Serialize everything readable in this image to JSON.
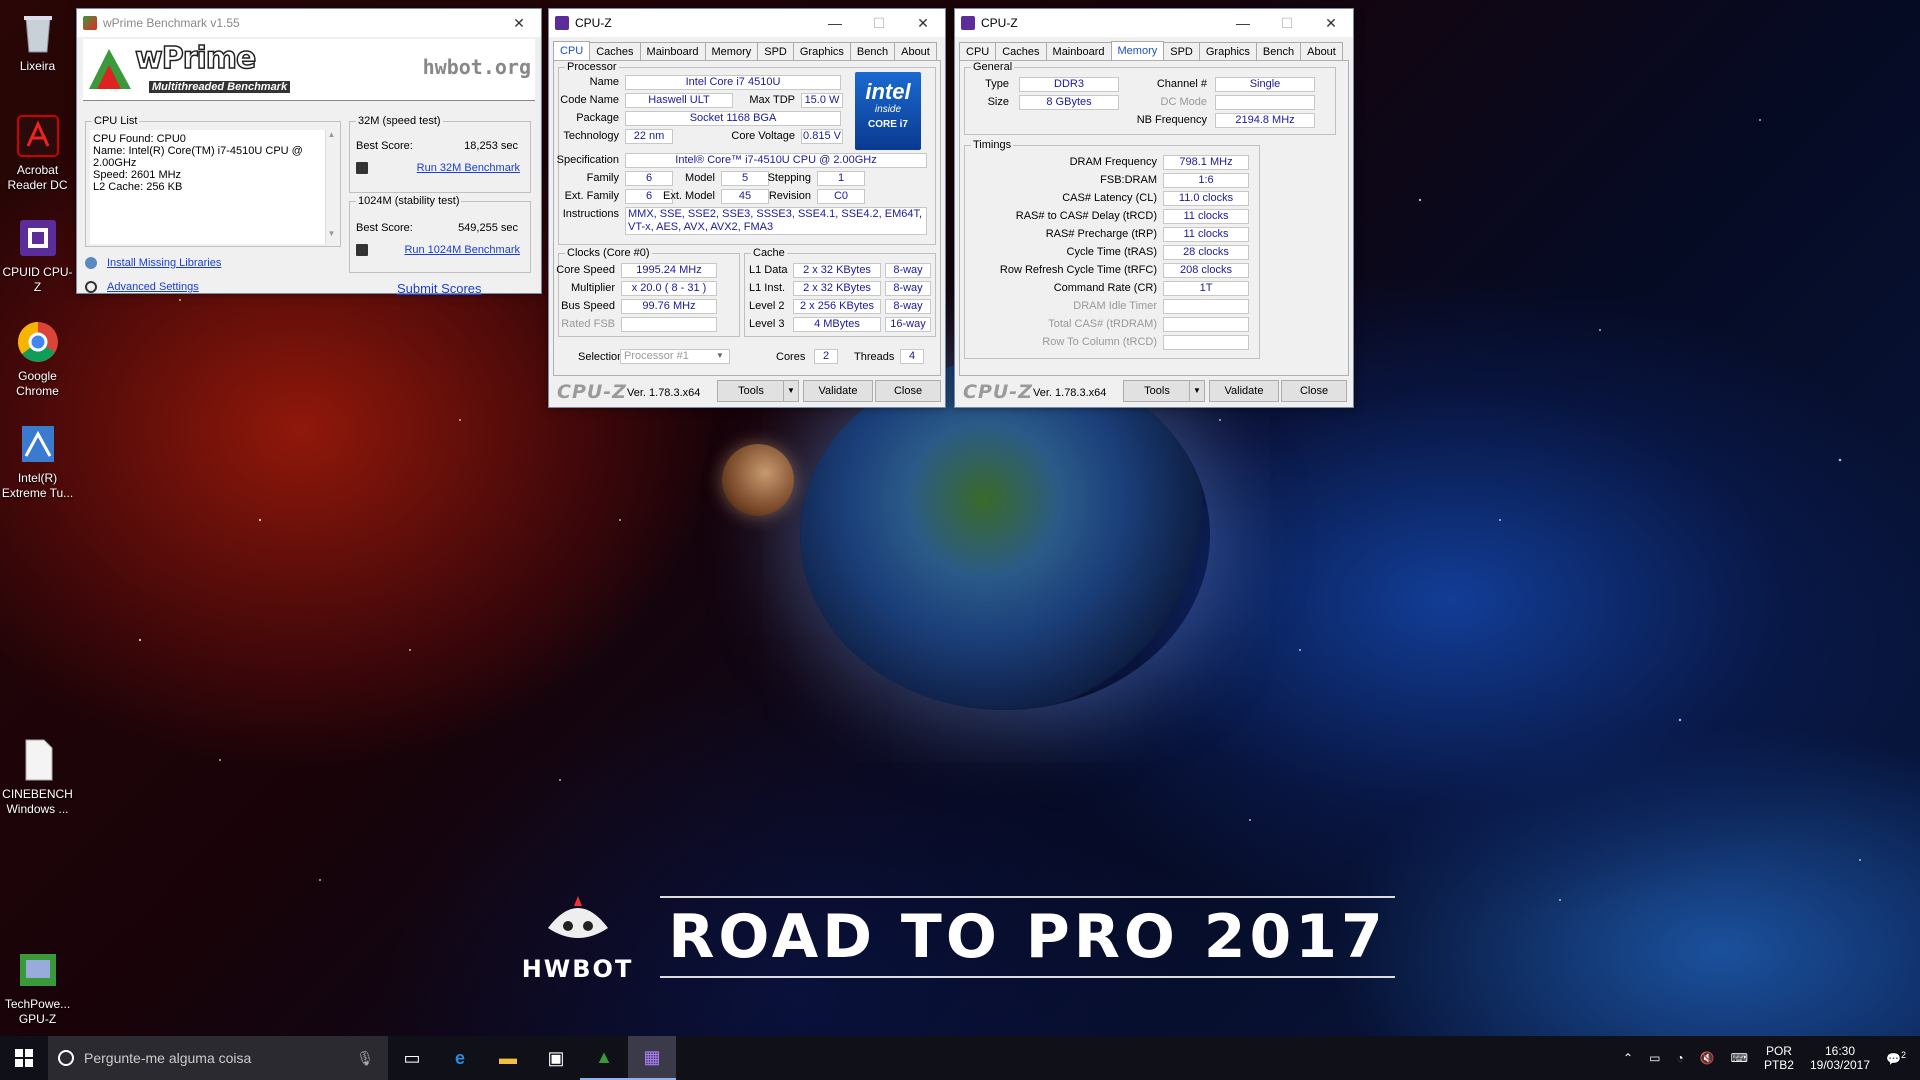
{
  "desktop": {
    "icons": [
      {
        "label": "Lixeira"
      },
      {
        "label": "Acrobat Reader DC"
      },
      {
        "label": "CPUID CPU-Z"
      },
      {
        "label": "Google Chrome"
      },
      {
        "label": "Intel(R) Extreme Tu..."
      },
      {
        "label": "CINEBENCH Windows ..."
      },
      {
        "label": "TechPowe... GPU-Z"
      }
    ],
    "banner": {
      "logo_text": "HWBOT",
      "title": "ROAD TO PRO 2017"
    }
  },
  "wprime": {
    "title": "wPrime Benchmark v1.55",
    "logo": "wPrime",
    "subtitle": "Multithreaded Benchmark",
    "hwbot": "hwbot.org",
    "cpu_list": {
      "label": "CPU List",
      "lines": [
        "CPU Found: CPU0",
        "Name:    Intel(R) Core(TM) i7-4510U CPU @",
        "2.00GHz",
        "Speed:    2601 MHz",
        "L2 Cache: 256 KB"
      ]
    },
    "test32": {
      "label": "32M (speed test)",
      "best_label": "Best Score:",
      "best": "18,253 sec",
      "run": "Run 32M Benchmark"
    },
    "test1024": {
      "label": "1024M (stability test)",
      "best_label": "Best Score:",
      "best": "549,255 sec",
      "run": "Run 1024M Benchmark"
    },
    "install_missing": "Install Missing Libraries",
    "advanced": "Advanced Settings",
    "submit": "Submit Scores"
  },
  "cpuz1": {
    "title": "CPU-Z",
    "tabs": [
      "CPU",
      "Caches",
      "Mainboard",
      "Memory",
      "SPD",
      "Graphics",
      "Bench",
      "About"
    ],
    "active_tab": "CPU",
    "processor": {
      "group": "Processor",
      "name_l": "Name",
      "name": "Intel Core i7 4510U",
      "code_l": "Code Name",
      "code": "Haswell ULT",
      "tdp_l": "Max TDP",
      "tdp": "15.0 W",
      "pkg_l": "Package",
      "pkg": "Socket 1168 BGA",
      "tech_l": "Technology",
      "tech": "22 nm",
      "volt_l": "Core Voltage",
      "volt": "0.815 V",
      "spec_l": "Specification",
      "spec": "Intel® Core™ i7-4510U CPU @ 2.00GHz",
      "family_l": "Family",
      "family": "6",
      "model_l": "Model",
      "model": "5",
      "stepping_l": "Stepping",
      "stepping": "1",
      "extfam_l": "Ext. Family",
      "extfam": "6",
      "extmod_l": "Ext. Model",
      "extmod": "45",
      "rev_l": "Revision",
      "rev": "C0",
      "instr_l": "Instructions",
      "instr": "MMX, SSE, SSE2, SSE3, SSSE3, SSE4.1, SSE4.2, EM64T, VT-x, AES, AVX, AVX2, FMA3",
      "logo_line1": "intel",
      "logo_line2": "inside",
      "logo_line3": "CORE i7"
    },
    "clocks": {
      "group": "Clocks (Core #0)",
      "core_l": "Core Speed",
      "core": "1995.24 MHz",
      "mult_l": "Multiplier",
      "mult": "x 20.0 ( 8 - 31 )",
      "bus_l": "Bus Speed",
      "bus": "99.76 MHz",
      "fsb_l": "Rated FSB",
      "fsb": ""
    },
    "cache": {
      "group": "Cache",
      "rows": [
        {
          "label": "L1 Data",
          "size": "2 x 32 KBytes",
          "way": "8-way"
        },
        {
          "label": "L1 Inst.",
          "size": "2 x 32 KBytes",
          "way": "8-way"
        },
        {
          "label": "Level 2",
          "size": "2 x 256 KBytes",
          "way": "8-way"
        },
        {
          "label": "Level 3",
          "size": "4 MBytes",
          "way": "16-way"
        }
      ]
    },
    "selection_l": "Selection",
    "selection": "Processor #1",
    "cores_l": "Cores",
    "cores": "2",
    "threads_l": "Threads",
    "threads": "4",
    "brand": "CPU-Z",
    "version": "Ver. 1.78.3.x64",
    "tools": "Tools",
    "validate": "Validate",
    "close": "Close"
  },
  "cpuz2": {
    "title": "CPU-Z",
    "tabs": [
      "CPU",
      "Caches",
      "Mainboard",
      "Memory",
      "SPD",
      "Graphics",
      "Bench",
      "About"
    ],
    "active_tab": "Memory",
    "general": {
      "group": "General",
      "type_l": "Type",
      "type": "DDR3",
      "size_l": "Size",
      "size": "8 GBytes",
      "chan_l": "Channel #",
      "chan": "Single",
      "dc_l": "DC Mode",
      "dc": "",
      "nb_l": "NB Frequency",
      "nb": "2194.8 MHz"
    },
    "timings": {
      "group": "Timings",
      "rows": [
        {
          "label": "DRAM Frequency",
          "value": "798.1 MHz",
          "disabled": false
        },
        {
          "label": "FSB:DRAM",
          "value": "1:6",
          "disabled": false
        },
        {
          "label": "CAS# Latency (CL)",
          "value": "11.0 clocks",
          "disabled": false
        },
        {
          "label": "RAS# to CAS# Delay (tRCD)",
          "value": "11 clocks",
          "disabled": false
        },
        {
          "label": "RAS# Precharge (tRP)",
          "value": "11 clocks",
          "disabled": false
        },
        {
          "label": "Cycle Time (tRAS)",
          "value": "28 clocks",
          "disabled": false
        },
        {
          "label": "Row Refresh Cycle Time (tRFC)",
          "value": "208 clocks",
          "disabled": false
        },
        {
          "label": "Command Rate (CR)",
          "value": "1T",
          "disabled": false
        },
        {
          "label": "DRAM Idle Timer",
          "value": "",
          "disabled": true
        },
        {
          "label": "Total CAS# (tRDRAM)",
          "value": "",
          "disabled": true
        },
        {
          "label": "Row To Column (tRCD)",
          "value": "",
          "disabled": true
        }
      ]
    },
    "brand": "CPU-Z",
    "version": "Ver. 1.78.3.x64",
    "tools": "Tools",
    "validate": "Validate",
    "close": "Close"
  },
  "taskbar": {
    "search_placeholder": "Pergunte-me alguma coisa",
    "lang1": "POR",
    "lang2": "PTB2",
    "time": "16:30",
    "date": "19/03/2017",
    "notif_count": "2"
  },
  "colors": {
    "accent": "#1a4fd0",
    "value_text": "#1a1aa0",
    "taskbar": "#101018"
  }
}
